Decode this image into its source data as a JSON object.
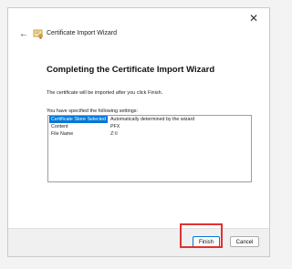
{
  "window": {
    "close_glyph": "✕",
    "back_glyph": "←",
    "title": "Certificate Import Wizard"
  },
  "main": {
    "heading": "Completing the Certificate Import Wizard",
    "description": "The certificate will be imported after you click Finish.",
    "settings_label": "You have specified the following settings:",
    "settings": [
      {
        "key": "Certificate Store Selected",
        "value": "Automatically determined by the wizard",
        "selected": true
      },
      {
        "key": "Content",
        "value": "PFX",
        "selected": false
      },
      {
        "key": "File Name",
        "value": "Z:\\ا",
        "selected": false
      }
    ]
  },
  "footer": {
    "finish_label": "Finish",
    "cancel_label": "Cancel"
  },
  "colors": {
    "selection": "#0078d7",
    "highlight": "#e03232"
  }
}
